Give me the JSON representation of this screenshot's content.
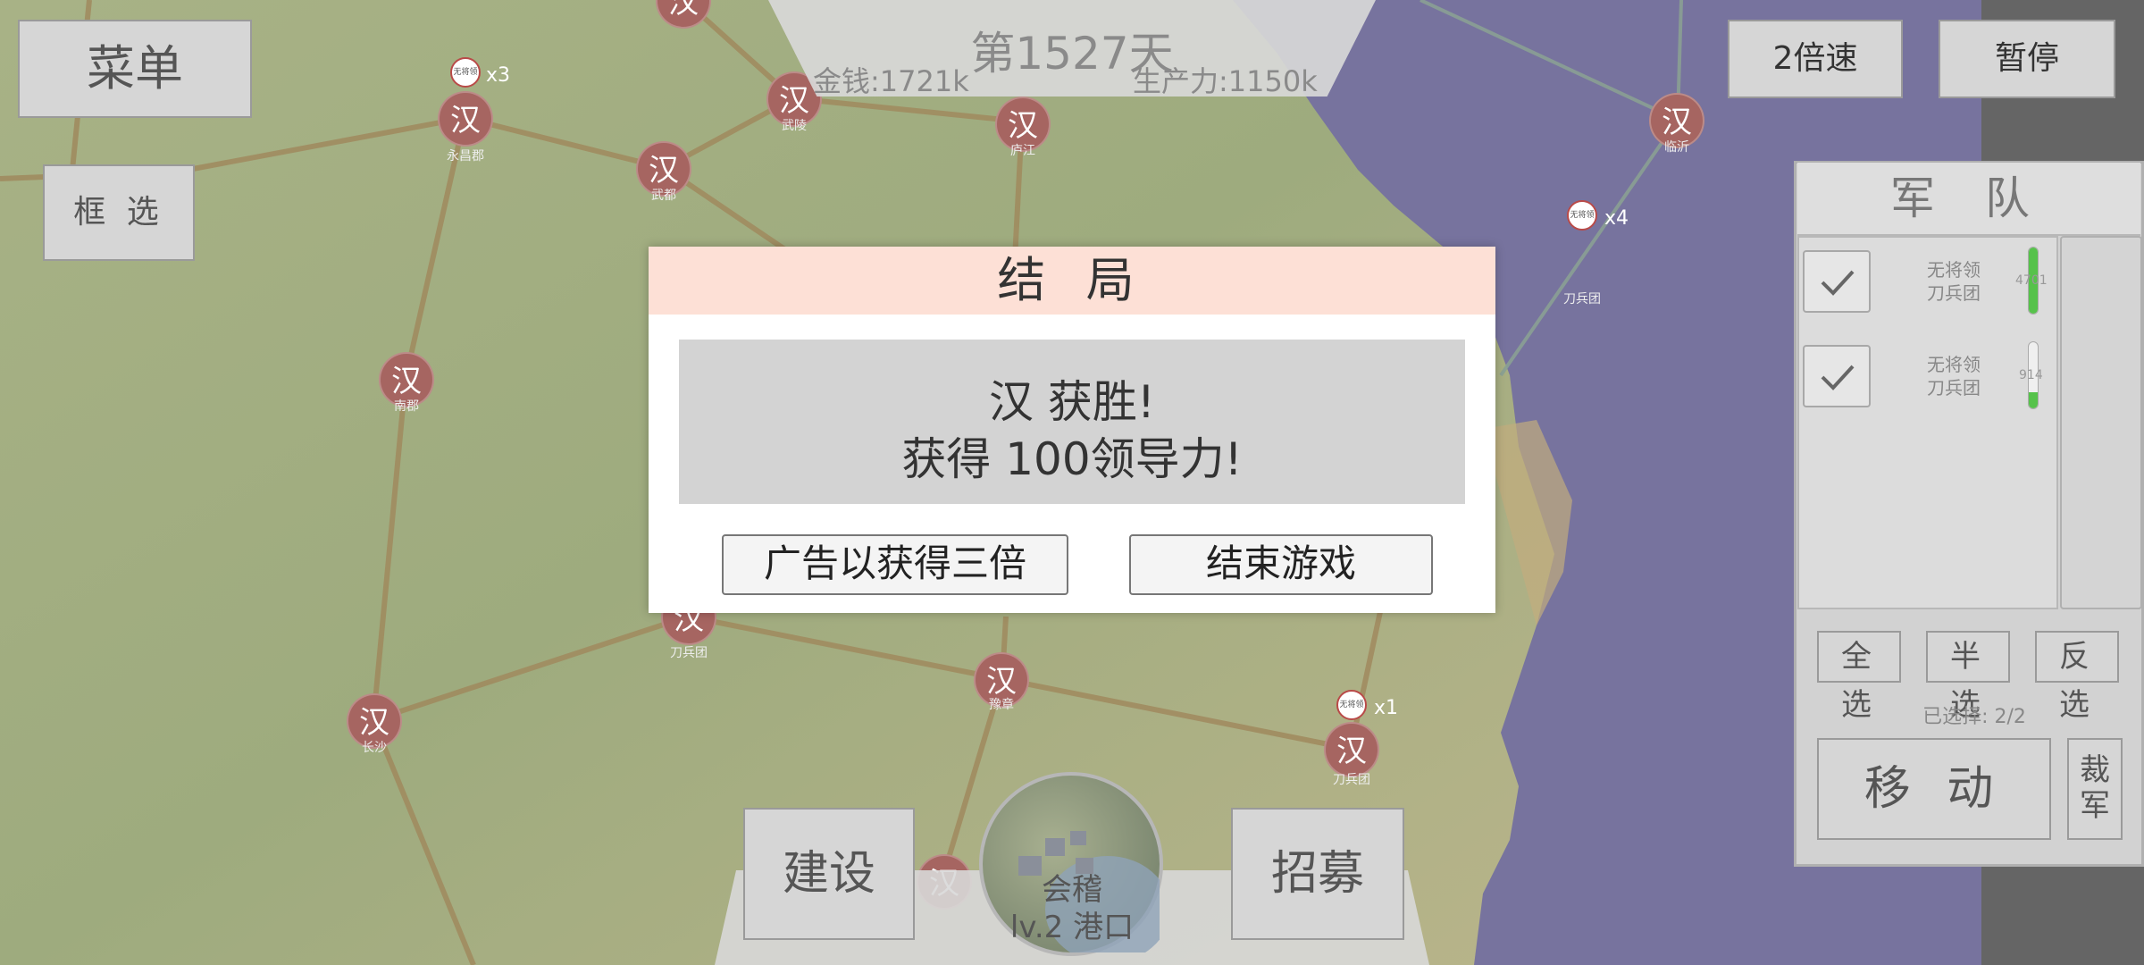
{
  "hud": {
    "menu_label": "菜单",
    "box_select_label": "框 选",
    "day_label": "第1527天",
    "money_label": "金钱:1721k",
    "production_label": "生产力:1150k",
    "speed_label": "2倍速",
    "pause_label": "暂停"
  },
  "map": {
    "city_glyph": "汉",
    "city_color": "#a66561",
    "cities": [
      {
        "label": ""
      },
      {
        "label": "永昌郡"
      },
      {
        "label": "武都"
      },
      {
        "label": "武陵"
      },
      {
        "label": "庐江"
      },
      {
        "label": "临沂"
      },
      {
        "label": "南郡"
      },
      {
        "label": "刀兵团"
      },
      {
        "label": "长沙"
      },
      {
        "label": "豫章"
      },
      {
        "label": "刀兵团"
      },
      {
        "label": ""
      }
    ],
    "markers": [
      {
        "text": "无将领",
        "count": "x3"
      },
      {
        "text": "无将领",
        "count": "x4"
      },
      {
        "text": "无将领",
        "count": "x1"
      }
    ],
    "free_labels": [
      "刀兵团"
    ]
  },
  "army": {
    "title": "军 队",
    "units": [
      {
        "line1": "无将领",
        "line2": "刀兵团",
        "value": "4701",
        "fill": 1.0
      },
      {
        "line1": "无将领",
        "line2": "刀兵团",
        "value": "914",
        "fill": 0.25
      }
    ],
    "select_all": "全 选",
    "select_half": "半 选",
    "select_invert": "反 选",
    "selected_text": "已选择: 2/2",
    "move_label": "移 动",
    "disband_label": "裁\n军",
    "bar_color": "#56c24b"
  },
  "dialog": {
    "title": "结 局",
    "line1": "汉 获胜!",
    "line2": "获得 100领导力!",
    "ad_button": "广告以获得三倍",
    "end_button": "结束游戏"
  },
  "bottom": {
    "build_label": "建设",
    "recruit_label": "招募",
    "city_name": "会稽",
    "city_level": "lv.2 港口"
  }
}
